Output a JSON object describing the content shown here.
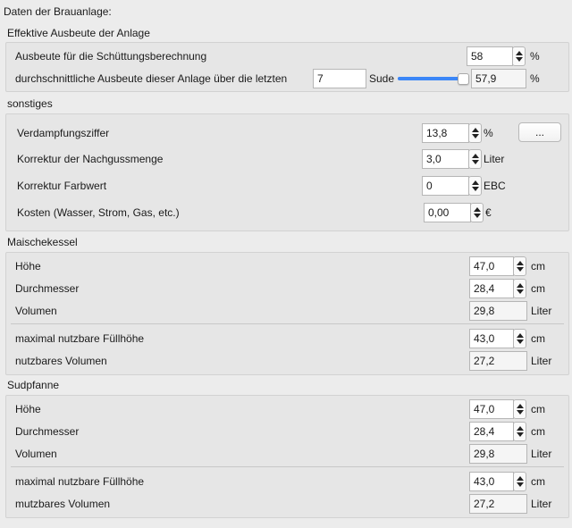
{
  "window": {
    "title": "Daten der Brauanlage:"
  },
  "effektive": {
    "title": "Effektive Ausbeute der Anlage",
    "row1": {
      "label": "Ausbeute für die Schüttungsberechnung",
      "value": "58",
      "unit": "%"
    },
    "row2": {
      "label": "durchschnittliche Ausbeute dieser Anlage über die letzten",
      "count": "7",
      "sude_label": "Sude",
      "slider_level": 1.0,
      "value": "57,9",
      "unit": "%"
    }
  },
  "sonstiges": {
    "title": "sonstiges",
    "verdampfung": {
      "label": "Verdampfungsziffer",
      "value": "13,8",
      "unit": "%",
      "button": "..."
    },
    "nachguss": {
      "label": "Korrektur der Nachgussmenge",
      "value": "3,0",
      "unit": "Liter"
    },
    "farbwert": {
      "label": "Korrektur Farbwert",
      "value": "0",
      "unit": "EBC"
    },
    "kosten": {
      "label": "Kosten (Wasser, Strom, Gas, etc.)",
      "value": "0,00",
      "unit": "€"
    }
  },
  "maischekessel": {
    "title": "Maischekessel",
    "hoehe": {
      "label": "Höhe",
      "value": "47,0",
      "unit": "cm"
    },
    "durchmesser": {
      "label": "Durchmesser",
      "value": "28,4",
      "unit": "cm"
    },
    "volumen": {
      "label": "Volumen",
      "value": "29,8",
      "unit": "Liter"
    },
    "max_fuellhoehe": {
      "label": "maximal nutzbare Füllhöhe",
      "value": "43,0",
      "unit": "cm"
    },
    "nutzbares_volumen": {
      "label": "nutzbares Volumen",
      "value": "27,2",
      "unit": "Liter"
    }
  },
  "sudpfanne": {
    "title": "Sudpfanne",
    "hoehe": {
      "label": "Höhe",
      "value": "47,0",
      "unit": "cm"
    },
    "durchmesser": {
      "label": "Durchmesser",
      "value": "28,4",
      "unit": "cm"
    },
    "volumen": {
      "label": "Volumen",
      "value": "29,8",
      "unit": "Liter"
    },
    "max_fuellhoehe": {
      "label": "maximal nutzbare Füllhöhe",
      "value": "43,0",
      "unit": "cm"
    },
    "nutzbares_volumen": {
      "label": "mutzbares Volumen",
      "value": "27,2",
      "unit": "Liter"
    }
  }
}
